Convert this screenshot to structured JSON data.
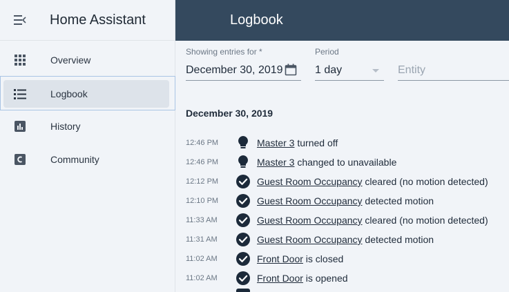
{
  "sidebar": {
    "title": "Home Assistant",
    "items": [
      {
        "label": "Overview",
        "icon": "grid-icon",
        "active": false
      },
      {
        "label": "Logbook",
        "icon": "list-icon",
        "active": true
      },
      {
        "label": "History",
        "icon": "bar-chart-icon",
        "active": false
      },
      {
        "label": "Community",
        "icon": "community-icon",
        "active": false
      }
    ]
  },
  "header": {
    "title": "Logbook"
  },
  "filters": {
    "date_label": "Showing entries for *",
    "date_value": "December 30, 2019",
    "period_label": "Period",
    "period_value": "1 day",
    "entity_placeholder": "Entity"
  },
  "log": {
    "date_heading": "December 30, 2019",
    "entries": [
      {
        "time": "12:46 PM",
        "icon": "lightbulb-icon",
        "entity": "Master 3",
        "message": " turned off"
      },
      {
        "time": "12:46 PM",
        "icon": "lightbulb-icon",
        "entity": "Master 3",
        "message": " changed to unavailable"
      },
      {
        "time": "12:12 PM",
        "icon": "check-circle-icon",
        "entity": "Guest Room Occupancy",
        "message": " cleared (no motion detected)"
      },
      {
        "time": "12:10 PM",
        "icon": "check-circle-icon",
        "entity": "Guest Room Occupancy",
        "message": " detected motion"
      },
      {
        "time": "11:33 AM",
        "icon": "check-circle-icon",
        "entity": "Guest Room Occupancy",
        "message": " cleared (no motion detected)"
      },
      {
        "time": "11:31 AM",
        "icon": "check-circle-icon",
        "entity": "Guest Room Occupancy",
        "message": " detected motion"
      },
      {
        "time": "11:02 AM",
        "icon": "check-circle-icon",
        "entity": "Front Door",
        "message": " is closed"
      },
      {
        "time": "11:02 AM",
        "icon": "check-circle-icon",
        "entity": "Front Door",
        "message": " is opened"
      }
    ]
  },
  "colors": {
    "header_bg": "#34495e",
    "sidebar_bg": "#f1f4f8",
    "active_item_bg": "#dde3ea",
    "icon_dark": "#1c2a3a"
  }
}
